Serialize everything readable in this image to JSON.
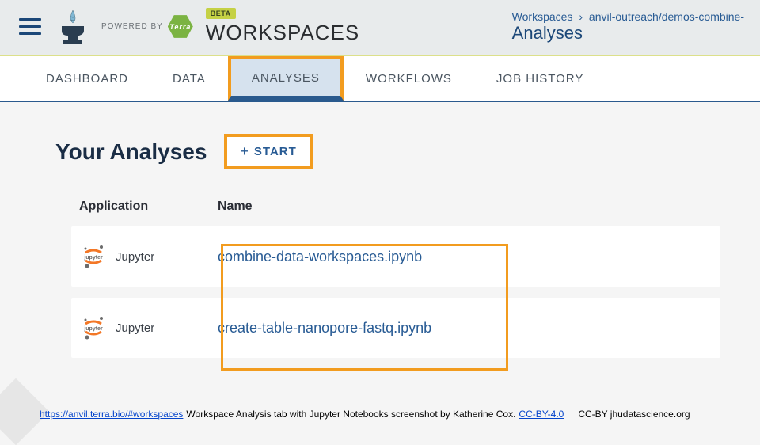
{
  "topbar": {
    "powered_label": "POWERED BY",
    "terra_label": "Terra",
    "beta_badge": "BETA",
    "workspaces_title": "WORKSPACES"
  },
  "breadcrumb": {
    "root": "Workspaces",
    "path": "anvil-outreach/demos-combine-",
    "current": "Analyses"
  },
  "tabs": {
    "dashboard": "DASHBOARD",
    "data": "DATA",
    "analyses": "ANALYSES",
    "workflows": "WORKFLOWS",
    "job_history": "JOB HISTORY"
  },
  "content": {
    "heading": "Your Analyses",
    "start_label": "START",
    "columns": {
      "application": "Application",
      "name": "Name"
    },
    "app_label": "Jupyter",
    "rows": [
      {
        "name": "combine-data-workspaces.ipynb"
      },
      {
        "name": "create-table-nanopore-fastq.ipynb"
      }
    ]
  },
  "footer": {
    "url": "https://anvil.terra.bio/#workspaces",
    "caption": "Workspace Analysis tab with Jupyter Notebooks screenshot by Katherine Cox.",
    "license_link": "CC-BY-4.0",
    "attribution": "CC-BY  jhudatascience.org"
  }
}
